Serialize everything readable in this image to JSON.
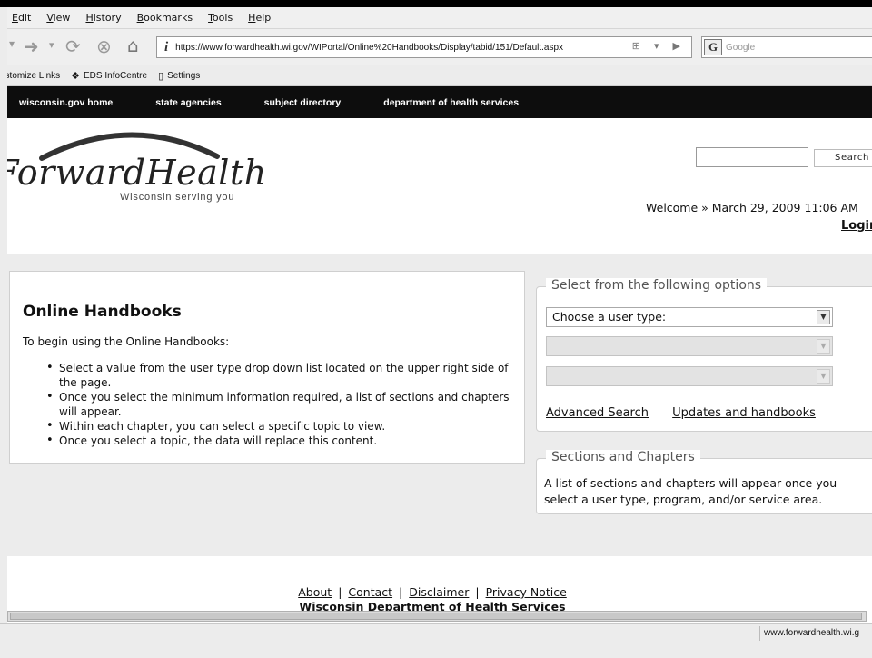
{
  "browser": {
    "menu": [
      "Edit",
      "View",
      "History",
      "Bookmarks",
      "Tools",
      "Help"
    ],
    "url": "https://www.forwardhealth.wi.gov/WIPortal/Online%20Handbooks/Display/tabid/151/Default.aspx",
    "search_placeholder": "Google",
    "bookmarks": [
      "ustomize Links",
      "EDS InfoCentre",
      "Settings"
    ],
    "status_url": "www.forwardhealth.wi.g"
  },
  "sitenav": [
    "wisconsin.gov home",
    "state agencies",
    "subject directory",
    "department of health services"
  ],
  "header": {
    "logo_name": "ForwardHealth",
    "logo_tagline": "Wisconsin serving you",
    "search_button": "Search",
    "welcome": "Welcome  » March 29, 2009 11:06 AM",
    "login": "Login"
  },
  "main": {
    "title": "Online Handbooks",
    "intro": "To begin using the Online Handbooks:",
    "bullets": [
      "Select a value from the user type drop down list located on the upper right side of the page.",
      "Once you select the minimum information required, a list of sections and chapters will appear.",
      "Within each chapter, you can select a specific topic to view.",
      "Once you select a topic, the data will replace this content."
    ]
  },
  "options": {
    "legend": "Select from the following options",
    "user_type": "Choose a user type:",
    "advanced_search": "Advanced Search",
    "updates": "Updates and handbooks"
  },
  "sections": {
    "legend": "Sections and Chapters",
    "text": "A list of sections and chapters will appear once you select a user type, program, and/or service area."
  },
  "footer": {
    "links": [
      "About",
      "Contact",
      "Disclaimer",
      "Privacy Notice"
    ],
    "org": "Wisconsin Department of Health Services"
  }
}
